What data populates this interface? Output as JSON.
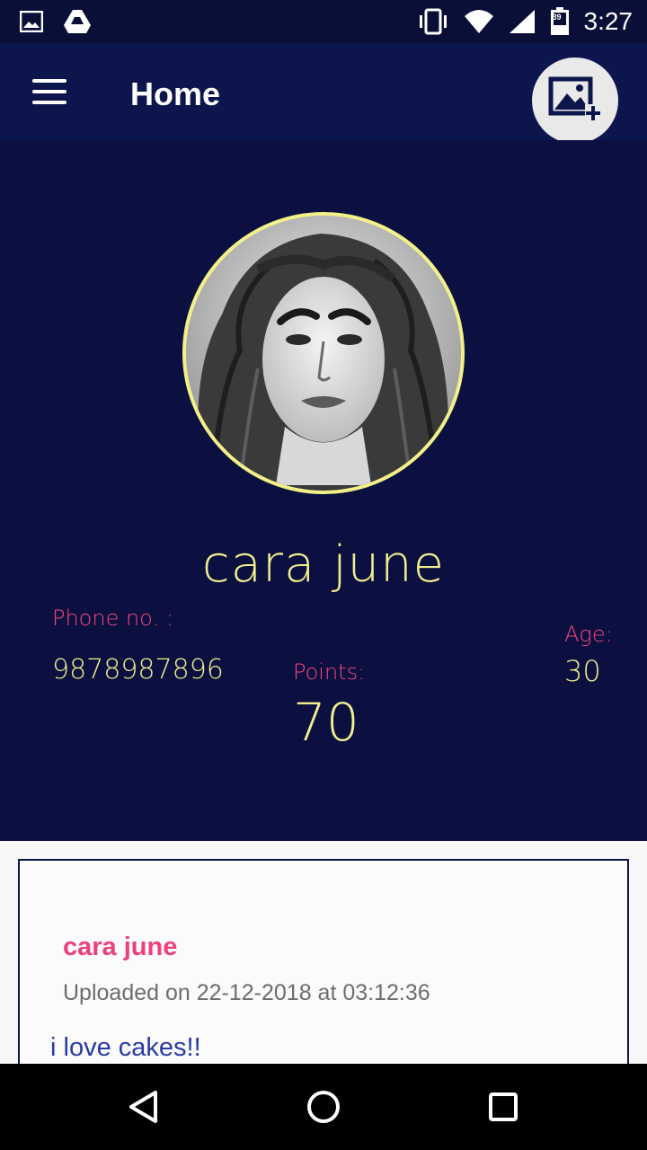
{
  "status_bar": {
    "time": "3:27",
    "battery_level": "39",
    "icons": [
      "image-icon",
      "drive-icon",
      "vibrate-icon",
      "wifi-icon",
      "signal-icon",
      "battery-icon"
    ]
  },
  "app_bar": {
    "title": "Home",
    "menu_icon": "hamburger-icon",
    "action_icon": "add-photo-icon"
  },
  "profile": {
    "name": "cara june",
    "phone_label": "Phone no. :",
    "phone_value": "9878987896",
    "points_label": "Points:",
    "points_value": "70",
    "age_label": "Age:",
    "age_value": "30"
  },
  "post": {
    "author": "cara june",
    "uploaded": "Uploaded on 22-12-2018 at 03:12:36",
    "text": "i love cakes!!"
  },
  "nav_bar": {
    "icons": [
      "back-icon",
      "home-icon",
      "recents-icon"
    ]
  },
  "colors": {
    "app_bar": "#0d154d",
    "profile_bg": "#0b1040",
    "name_yellow": "#f1ee90",
    "label_pink": "#f1457e",
    "post_text_blue": "#2b3aa5"
  }
}
